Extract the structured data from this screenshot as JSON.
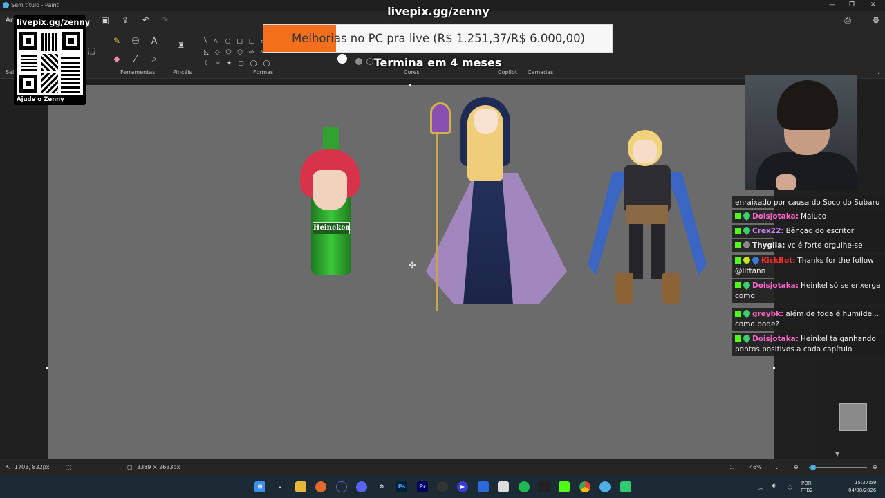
{
  "window": {
    "title": "Sem título - Paint"
  },
  "ribbon": {
    "groups": [
      "Ferramentas",
      "Pincéis",
      "Formas",
      "Cores",
      "Copilot",
      "Camadas"
    ],
    "tab_fragment": "Ar",
    "select_fragment": "Sel"
  },
  "overlay": {
    "qr_header": "livepix.gg/zenny",
    "qr_footer": "Ajude o Zenny",
    "goal_title": "livepix.gg/zenny",
    "goal_text": "Melhorias no PC pra live (R$ 1.251,37/R$ 6.000,00)",
    "goal_progress": 0.2086,
    "goal_subtitle": "Termina em 4 meses"
  },
  "canvas": {
    "bottle_label": "Heineken"
  },
  "chat": [
    {
      "user": "",
      "message": "enraixado por causa do Soco do Subaru",
      "user_color": "#ffffff"
    },
    {
      "user": "Doisjotaka:",
      "message": "Maluco",
      "user_color": "#ff66cc"
    },
    {
      "user": "Crex22:",
      "message": "Bênção do escritor",
      "user_color": "#d184ff"
    },
    {
      "user": "Thyglia:",
      "message": "vc é forte orgulhe-se",
      "user_color": "#e8e8e8"
    },
    {
      "user": "KickBot:",
      "message": "Thanks for the follow @littann",
      "user_color": "#ff2a2a"
    },
    {
      "user": "Doisjotaka:",
      "message": "Heinkel só se enxerga como",
      "user_color": "#ff66cc"
    },
    {
      "user": "greybk:",
      "message": "além de foda é humilde... como pode?",
      "user_color": "#ff66cc"
    },
    {
      "user": "Doisjotaka:",
      "message": "Heinkel tá ganhando pontos positivos a cada capítulo",
      "user_color": "#ff66cc"
    }
  ],
  "status": {
    "cursor_pos": "1703, 832px",
    "canvas_size": "3389 × 2633px",
    "zoom": "46%"
  },
  "taskbar": {
    "lang": "POR",
    "layout": "PTB2",
    "time": "15:37:59",
    "date": "04/08/2026"
  }
}
